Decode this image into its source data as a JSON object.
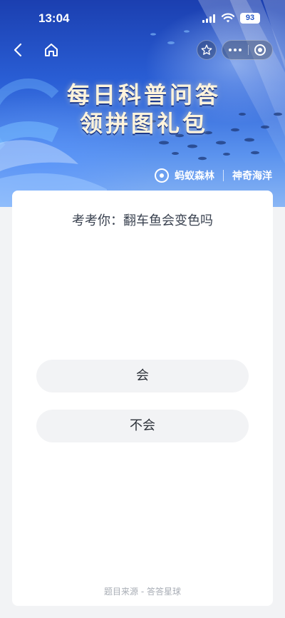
{
  "status_bar": {
    "time": "13:04",
    "battery": "93"
  },
  "nav": {
    "back_icon": "chevron-left-icon",
    "home_icon": "home-icon",
    "favorite_icon": "star-icon",
    "more_icon": "more-dots-icon",
    "close_icon": "target-circle-icon"
  },
  "banner": {
    "title_line1": "每日科普问答",
    "title_line2": "领拼图礼包",
    "brand_primary": "蚂蚁森林",
    "brand_secondary": "神奇海洋",
    "colors": {
      "top": "#1b3fb0",
      "bottom": "#8ab6f5",
      "title": "#fff4dc"
    }
  },
  "quiz": {
    "question": "考考你：翻车鱼会变色吗",
    "options": [
      {
        "label": "会"
      },
      {
        "label": "不会"
      }
    ],
    "source": "题目来源 - 答答星球"
  }
}
